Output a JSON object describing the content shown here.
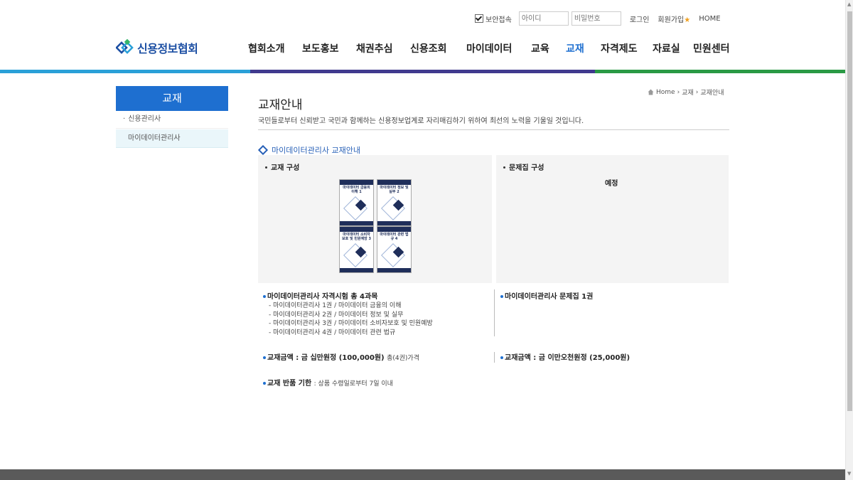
{
  "util": {
    "secure_label": "보안접속",
    "id_placeholder": "아이디",
    "pw_placeholder": "비밀번호",
    "login": "로그인",
    "join": "회원가입",
    "home": "HOME"
  },
  "logo": {
    "text": "신용정보협회"
  },
  "gnb": [
    "협회소개",
    "보도홍보",
    "채권추심",
    "신용조회",
    "마이데이터",
    "교육",
    "교재",
    "자격제도",
    "자료실",
    "민원센터"
  ],
  "colors": {
    "accent": "#1e6fd0",
    "active_nav": "#1e6fd0",
    "bar_blue": "#2aa0d8",
    "bar_indigo": "#403a8e",
    "bar_green": "#2a9a45"
  },
  "lnb": {
    "title": "교재",
    "items": [
      "신용관리사",
      "마이데이터관리사"
    ]
  },
  "breadcrumb": [
    "Home",
    "교재",
    "교재안내"
  ],
  "page": {
    "title": "교재안내",
    "desc": "국민들로부터 신뢰받고 국민과 함께하는 신용정보업계로 자리매김하기 위하여 최선의 노력을 기울일 것입니다."
  },
  "section": {
    "title": "마이데이터관리사 교재안내",
    "left_label": "교재 구성",
    "right_label": "문제집 구성",
    "right_note": "예정",
    "books": [
      "마이데이터 금융의 이해 1",
      "마이데이터 정보 및 실무 2",
      "마이데이터 소비자보호 및 민원예방 3",
      "마이데이터 관련 법규 4"
    ]
  },
  "info": {
    "left_heading": "마이데이터관리사 자격시험 총 4과목",
    "left_items": [
      "- 마이데이터관리사 1권 / 마이데이터 금융의 이해",
      "- 마이데이터관리사 2권 / 마이데이터 정보 및 실무",
      "- 마이데이터관리사 3권 / 마이데이터 소비자보호 및 민원예방",
      "- 마이데이터관리사 4권 / 마이데이터 관련 법규"
    ],
    "right_heading": "마이데이터관리사 문제집 1권",
    "left_price": "교재금액 : 금 십만원정 (100,000원)",
    "left_price_suffix": "총(4권)가격",
    "right_price": "교재금액 : 금 이만오천원정 (25,000원)",
    "refund_label": "교재 반품 기한",
    "refund_value": ": 상품 수령일로부터 7일 이내"
  }
}
